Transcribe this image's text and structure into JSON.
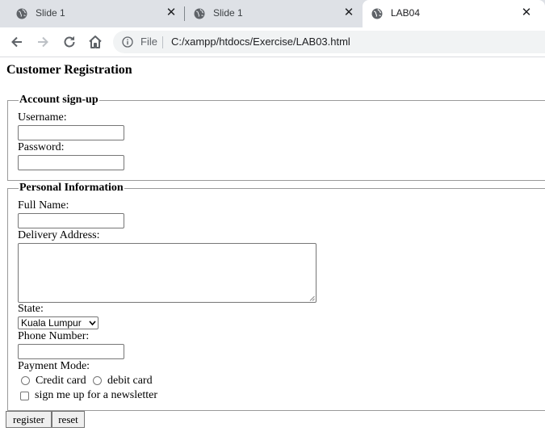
{
  "browser": {
    "tabs": [
      {
        "title": "Slide 1",
        "close": "✕",
        "active": false
      },
      {
        "title": "Slide 1",
        "close": "✕",
        "active": false
      },
      {
        "title": "LAB04",
        "close": "✕",
        "active": true
      }
    ],
    "address": {
      "scheme_label": "File",
      "url": "C:/xampp/htdocs/Exercise/LAB03.html"
    }
  },
  "page": {
    "title": "Customer Registration",
    "account_section": {
      "legend": "Account sign-up",
      "username_label": "Username:",
      "username_value": "",
      "password_label": "Password:",
      "password_value": ""
    },
    "personal_section": {
      "legend": "Personal Information",
      "fullname_label": "Full Name:",
      "fullname_value": "",
      "address_label": "Delivery Address:",
      "address_value": "",
      "state_label": "State:",
      "state_selected": "Kuala Lumpur",
      "phone_label": "Phone Number:",
      "phone_value": "",
      "payment_label": "Payment Mode:",
      "payment_options": [
        "Credit card",
        "debit card"
      ],
      "payment_selected": null,
      "newsletter_label": "sign me up for a newsletter",
      "newsletter_checked": false
    },
    "buttons": {
      "register": "register",
      "reset": "reset"
    }
  }
}
